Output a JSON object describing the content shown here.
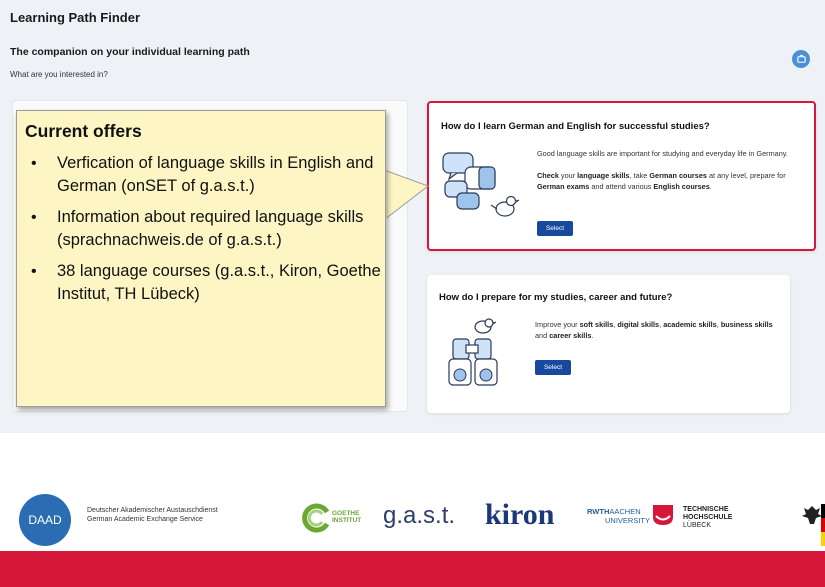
{
  "app": {
    "title": "Learning Path Finder",
    "subtitle": "The companion on your individual learning path",
    "prompt": "What are you interested in?"
  },
  "cards": [
    {
      "title": "How do I learn German and English for successful studies?",
      "text": "Good language skills are important for studying and everyday life in Germany.",
      "text2_parts": [
        "Check",
        " your ",
        "language skills",
        ", take ",
        "German courses",
        " at any level, prepare for ",
        "German exams",
        " and attend various ",
        "English courses",
        "."
      ],
      "button": "Select",
      "selected": true,
      "illustration": "speech-bubbles-bird-icon"
    },
    {
      "title": "How do I prepare for my studies, career and future?",
      "text_parts": [
        "Improve your ",
        "soft skills",
        ", ",
        "digital skills",
        ", ",
        "academic skills",
        ", ",
        "business skills",
        " and ",
        "career skills",
        "."
      ],
      "button": "Select",
      "selected": false,
      "illustration": "binoculars-bird-icon"
    }
  ],
  "callout": {
    "title": "Current offers",
    "items": [
      "Verfication of language skills in English and German (onSET of g.a.s.t.)",
      "Information about required language skills (sprachnachweis.de of g.a.s.t.)",
      "38 language courses (g.a.s.t., Kiron, Goethe Institut, TH Lübeck)"
    ]
  },
  "logos": {
    "daad": {
      "mark": "DAAD",
      "line1": "Deutscher Akademischer Austauschdienst",
      "line2": "German Academic Exchange Service"
    },
    "goethe": {
      "line1": "GOETHE",
      "line2": "INSTITUT"
    },
    "gast": "g.a.s.t.",
    "kiron": "kiron",
    "rwth": {
      "line1_bold": "RWTH",
      "line1_rest": "AACHEN",
      "line2": "UNIVERSITY"
    },
    "th": {
      "line1": "TECHNISCHE",
      "line2": "HOCHSCHULE",
      "line3": "LÜBECK"
    }
  },
  "colors": {
    "accent_red": "#d6173a",
    "button_blue": "#17499e",
    "callout_yellow": "#fdf6c4",
    "panel_bg": "#eef1f6"
  },
  "icons": {
    "corner": "edit-icon",
    "daad": "daad-logo-icon",
    "goethe": "goethe-logo-icon",
    "th": "th-luebeck-logo-icon",
    "eagle": "federal-eagle-icon"
  }
}
